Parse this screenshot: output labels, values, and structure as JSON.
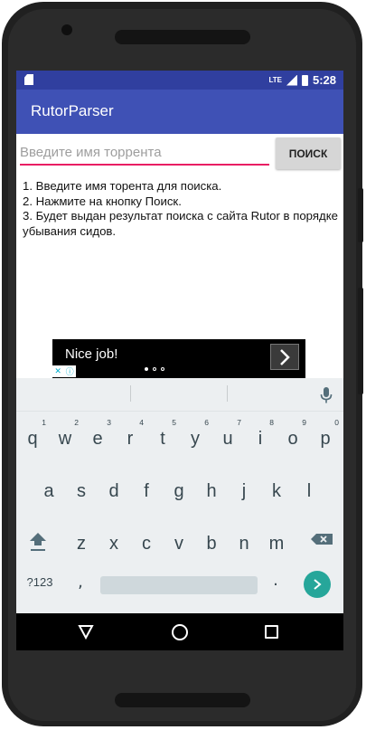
{
  "status_bar": {
    "time": "5:28",
    "network": "LTE",
    "icons": [
      "sd-card-icon",
      "signal-icon",
      "battery-icon"
    ]
  },
  "app_bar": {
    "title": "RutorParser"
  },
  "search": {
    "placeholder": "Введите имя торрента",
    "value": "",
    "button_label": "ПОИСК"
  },
  "instructions": [
    "1. Введите имя торента для поиска.",
    "2. Нажмите на кнопку Поиск.",
    "3. Будет выдан результат поиска с сайта Rutor в порядке убывания сидов."
  ],
  "ad": {
    "text": "Nice job!",
    "dots_total": 3,
    "active_dot": 1
  },
  "keyboard": {
    "row1": [
      {
        "key": "q",
        "hint": "1"
      },
      {
        "key": "w",
        "hint": "2"
      },
      {
        "key": "e",
        "hint": "3"
      },
      {
        "key": "r",
        "hint": "4"
      },
      {
        "key": "t",
        "hint": "5"
      },
      {
        "key": "y",
        "hint": "6"
      },
      {
        "key": "u",
        "hint": "7"
      },
      {
        "key": "i",
        "hint": "8"
      },
      {
        "key": "o",
        "hint": "9"
      },
      {
        "key": "p",
        "hint": "0"
      }
    ],
    "row2": [
      "a",
      "s",
      "d",
      "f",
      "g",
      "h",
      "j",
      "k",
      "l"
    ],
    "row3": [
      "z",
      "x",
      "c",
      "v",
      "b",
      "n",
      "m"
    ],
    "symbols_label": "?123",
    "comma_label": ",",
    "period_label": "."
  },
  "colors": {
    "status_bar": "#303f9f",
    "app_bar": "#3f51b5",
    "input_underline": "#e91e63",
    "enter_key": "#26a69a",
    "keyboard_bg": "#eceff1"
  }
}
